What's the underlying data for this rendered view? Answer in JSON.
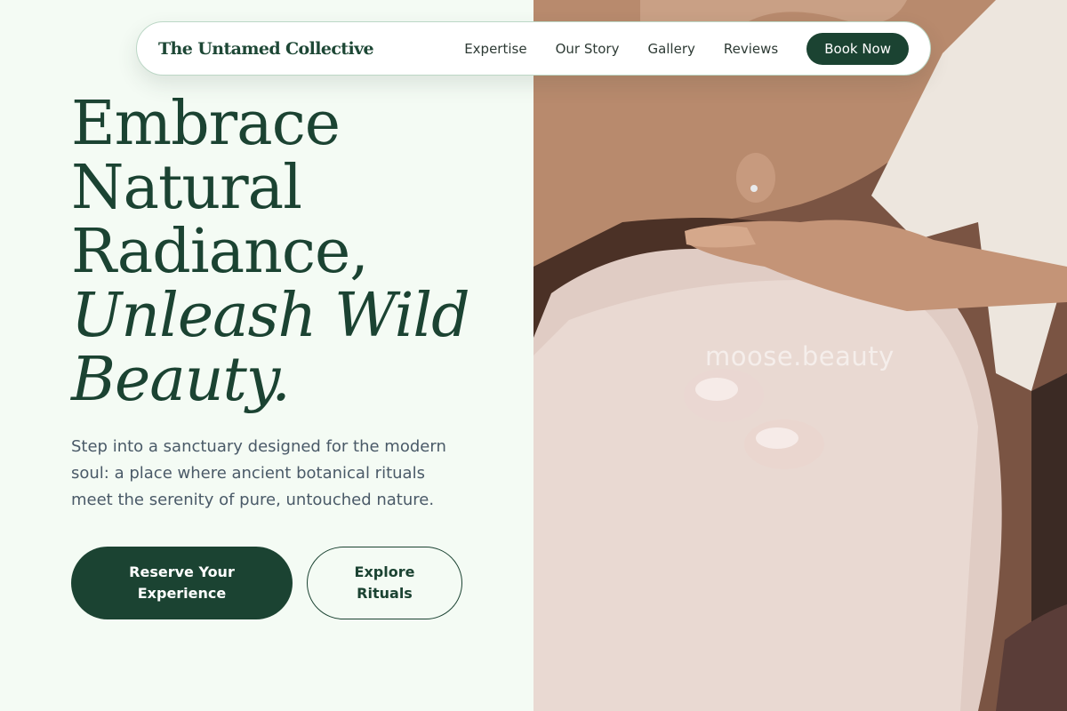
{
  "nav": {
    "brand": "The Untamed Collective",
    "links": [
      "Expertise",
      "Our Story",
      "Gallery",
      "Reviews"
    ],
    "cta": "Book Now"
  },
  "hero": {
    "headline_lines": [
      "Embrace",
      "Natural",
      "Radiance,"
    ],
    "headline_italic_lines": [
      "Unleash Wild",
      "Beauty."
    ],
    "lead": "Step into a sanctuary designed for the modern soul: a place where ancient botanical rituals meet the serenity of pure, untouched nature.",
    "primary_cta": "Reserve Your Experience",
    "secondary_cta": "Explore Rituals"
  },
  "photo": {
    "watermark": "moose.beauty"
  },
  "colors": {
    "brand_green": "#1b4332",
    "background": "#f4fbf4",
    "body_text": "#4a5a68"
  }
}
